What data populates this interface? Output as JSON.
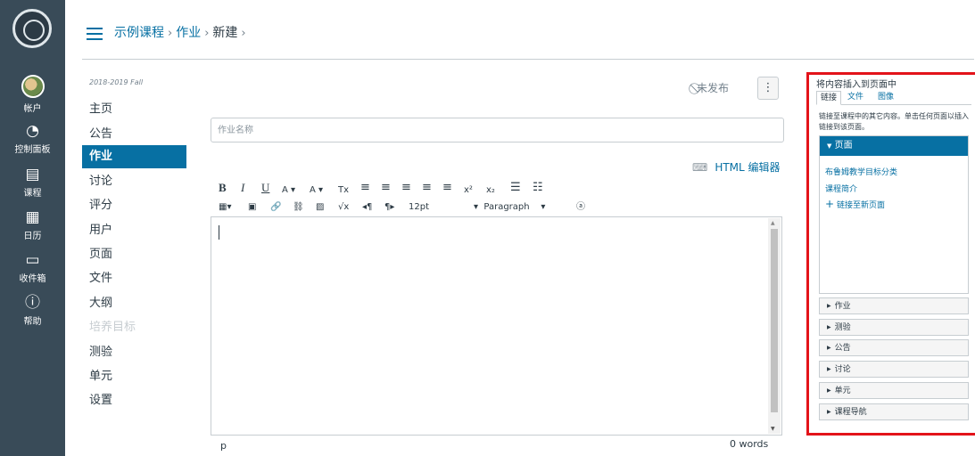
{
  "global_nav": {
    "items": [
      {
        "label": "帐户",
        "icon": "avatar"
      },
      {
        "label": "控制面板",
        "icon": "dashboard-icon"
      },
      {
        "label": "课程",
        "icon": "book-icon"
      },
      {
        "label": "日历",
        "icon": "calendar-icon"
      },
      {
        "label": "收件箱",
        "icon": "inbox-icon"
      },
      {
        "label": "帮助",
        "icon": "help-icon"
      }
    ],
    "active_label": "课程",
    "colors": {
      "background": "#394b58",
      "active_text": "#0770a3"
    }
  },
  "breadcrumb": {
    "course": "示例课程",
    "section": "作业",
    "current": "新建",
    "separator": "›"
  },
  "course_nav": {
    "term": "2018-2019 Fall",
    "items": [
      "主页",
      "公告",
      "作业",
      "讨论",
      "评分",
      "用户",
      "页面",
      "文件",
      "大纲",
      "培养目标",
      "测验",
      "单元",
      "设置"
    ],
    "active_item": "作业",
    "disabled_item": "培养目标"
  },
  "header": {
    "status": "未发布",
    "more_button": "⋮"
  },
  "assignment": {
    "name_placeholder": "作业名称",
    "html_editor_label": "HTML 编辑器"
  },
  "toolbar": {
    "row1": [
      "B",
      "I",
      "U",
      "A ▾",
      "A ▾",
      "Tx",
      "≡",
      "≡",
      "≡",
      "≡",
      "≡",
      "x²",
      "x₂",
      "☰",
      "☷"
    ],
    "font_size": "12pt",
    "paragraph": "Paragraph"
  },
  "editor": {
    "path": "p",
    "word_count": "0 words"
  },
  "panel": {
    "title": "将内容插入到页面中",
    "tabs": [
      "链接",
      "文件",
      "图像"
    ],
    "active_tab": "链接",
    "description": "链接至课程中的其它内容。单击任何页面以插入链接到该页面。",
    "open_section": "页面",
    "page_links": [
      "布鲁姆教学目标分类",
      "课程简介"
    ],
    "new_page_link": "链接至新页面",
    "sections": [
      "作业",
      "测验",
      "公告",
      "讨论",
      "单元",
      "课程导航"
    ],
    "accent": "#0770a3",
    "highlight_border": "#e3131a"
  }
}
